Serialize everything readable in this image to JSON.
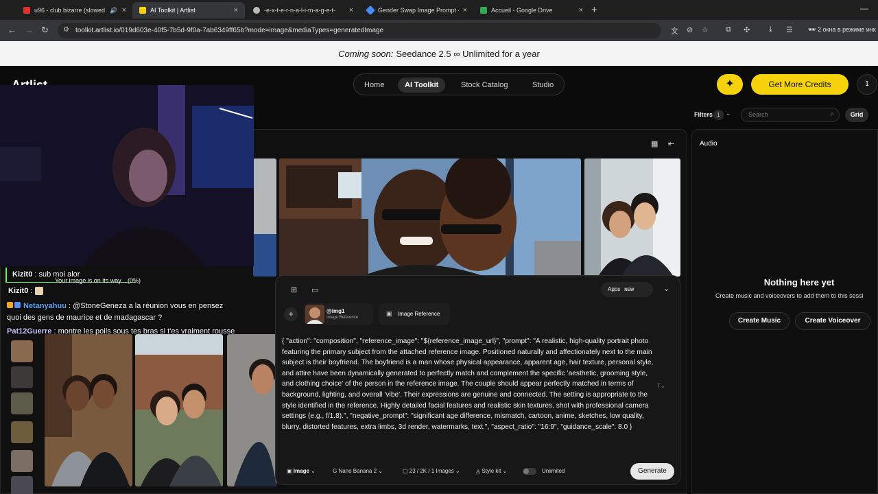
{
  "browser": {
    "tabs": [
      {
        "title": "u96 - club bizarre (slowed",
        "fav_color": "#e03030",
        "has_audio": true
      },
      {
        "title": "AI Toolkit | Artlist",
        "fav_color": "#f5d20c",
        "active": true
      },
      {
        "title": "-e-x-t-e-r-n-a-l-i-m-a-g-e-t-",
        "fav_color": "#bbbbbb"
      },
      {
        "title": "Gender Swap Image Prompt - ",
        "fav_color": "#4a8cf7"
      },
      {
        "title": "Accueil - Google Drive",
        "fav_color": "#34a853"
      }
    ],
    "url": "toolkit.artlist.io/019d603e-40f5-7b5d-9f0a-7ab6349ff65b?mode=image&mediaTypes=generatedImage",
    "incognito_label": "2 окна в режиме инк"
  },
  "banner": {
    "prefix": "Coming soon:",
    "text": "Seedance 2.5 ∞ Unlimited for a year"
  },
  "header": {
    "logo": "Artlist",
    "nav": [
      {
        "label": "Home"
      },
      {
        "label": "AI Toolkit",
        "active": true
      },
      {
        "label": "Stock Catalog"
      },
      {
        "label": "Studio"
      }
    ],
    "spark_icon": "✦",
    "credits_label": "Get More Credits",
    "account_label": "1"
  },
  "filters": {
    "label": "Filters",
    "count": "1",
    "search_placeholder": "Search",
    "grid_label": "Grid"
  },
  "audio": {
    "title": "Audio",
    "empty_title": "Nothing here yet",
    "empty_sub": "Create music and voiceovers to add them to this sessi",
    "create_music": "Create Music",
    "create_voiceover": "Create Voiceover"
  },
  "prompt": {
    "apps_label": "Apps",
    "apps_badge": "NEW",
    "ref_chip": {
      "name": "@img1",
      "kind": "Image Reference"
    },
    "image_ref_label": "Image Reference",
    "text": "{ \"action\": \"composition\", \"reference_image\": \"${reference_image_url}\", \"prompt\": \"A realistic, high-quality portrait photo featuring the primary subject from the attached reference image. Positioned naturally and affectionately next to the main subject is their boyfriend. The boyfriend is a man whose physical appearance, apparent age, hair texture, personal style, and attire have been dynamically generated to perfectly match and complement the specific 'aesthetic, grooming style, and clothing choice' of the person in the reference image. The couple should appear perfectly matched in terms of background, lighting, and overall 'vibe'. Their expressions are genuine and connected. The setting is appropriate to the style identified in the reference. Highly detailed facial features and realistic skin textures, shot with professional camera settings (e.g., f/1.8).\", \"negative_prompt\": \"significant age difference, mismatch, cartoon, anime, sketches, low quality, blurry, distorted features, extra limbs, 3d render, watermarks, text.\", \"aspect_ratio\": \"16:9\", \"guidance_scale\": 8.0 }",
    "mode": "Image",
    "model": "Nano Banana 2",
    "settings": "23 / 2K / 1 Images",
    "style": "Style kit",
    "unlimited": "Unlimited",
    "generate": "Generate"
  },
  "overlay": {
    "status": "Your image is on its way... (0%)",
    "chat": [
      {
        "user": "Kizit0",
        "msg": "sub moi alor",
        "color": "#ffffff"
      },
      {
        "user": "Kizit0",
        "msg": "",
        "color": "#ffffff"
      },
      {
        "user": "Netanyahuu",
        "msg": "@StoneGeneza a la réunion vous en pensez",
        "color": "#58a6ff"
      },
      {
        "user": "",
        "msg": "quoi des gens de maurice et de madagascar ?",
        "color": "#ffffff"
      },
      {
        "user": "Pat12Guerre",
        "msg": "montre les poils sous tes bras si t'es vraiment rousse",
        "color": "#c9c9ff"
      }
    ]
  },
  "icons": {
    "back": "←",
    "forward": "→",
    "reload": "↻",
    "site_settings": "⚙",
    "translate": "文",
    "eye_off": "⊘",
    "star": "☆",
    "extension": "⧉",
    "puzzle": "✣",
    "download": "⤓",
    "menu": "☰",
    "incognito": "🕶",
    "grid_view": "▦",
    "collapse": "⇤",
    "apps_grid": "⊞",
    "chat": "▭",
    "chevron_down": "⌄",
    "plus": "+",
    "image": "▣",
    "search": "⌕",
    "new_tab": "+",
    "minimize": "—",
    "close": "✕"
  }
}
